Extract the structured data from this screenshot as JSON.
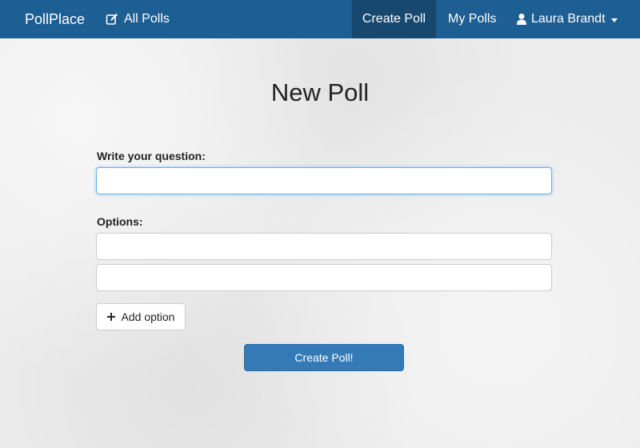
{
  "navbar": {
    "brand": "PollPlace",
    "all_polls": {
      "label": "All Polls",
      "icon": "edit-icon"
    },
    "create_poll": {
      "label": "Create Poll",
      "active": true
    },
    "my_polls": {
      "label": "My Polls"
    },
    "user": {
      "name": "Laura Brandt",
      "icon": "user-icon",
      "menu_icon": "caret-down-icon"
    },
    "colors": {
      "bar": "#1d5e93",
      "active": "#17486f"
    }
  },
  "main": {
    "title": "New Poll",
    "question_label": "Write your question:",
    "question_value": "",
    "options_label": "Options:",
    "options": [
      "",
      ""
    ],
    "add_option_label": "Add option",
    "add_option_icon": "plus-icon",
    "submit_label": "Create Poll!",
    "colors": {
      "submit": "#337ab7",
      "focus_ring": "#66afe9"
    }
  }
}
